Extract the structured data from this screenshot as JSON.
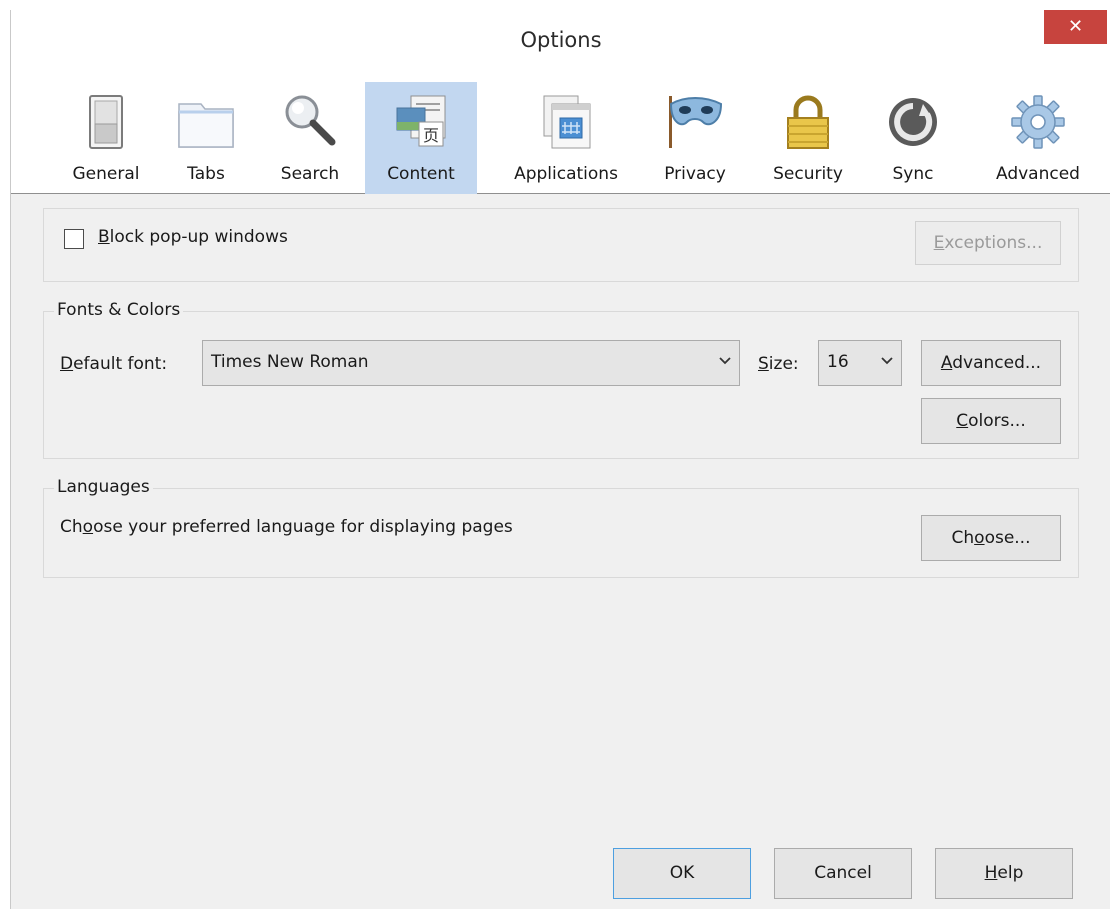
{
  "window": {
    "title": "Options",
    "close_glyph": "✕"
  },
  "tabs": [
    {
      "label": "General",
      "icon": "switch-icon"
    },
    {
      "label": "Tabs",
      "icon": "folder-tabs-icon"
    },
    {
      "label": "Search",
      "icon": "magnifier-icon"
    },
    {
      "label": "Content",
      "icon": "content-pages-icon",
      "selected": true
    },
    {
      "label": "Applications",
      "icon": "applications-window-icon"
    },
    {
      "label": "Privacy",
      "icon": "mask-icon"
    },
    {
      "label": "Security",
      "icon": "padlock-icon"
    },
    {
      "label": "Sync",
      "icon": "sync-icon"
    },
    {
      "label": "Advanced",
      "icon": "gear-icon"
    }
  ],
  "popups": {
    "block_label_accesskey": "B",
    "block_label_rest": "lock pop-up windows",
    "block_checked": false,
    "exceptions_accesskey": "E",
    "exceptions_rest": "xceptions...",
    "exceptions_disabled": true
  },
  "fonts": {
    "legend": "Fonts & Colors",
    "default_font_accesskey": "D",
    "default_font_rest": "efault font:",
    "default_font_value": "Times New Roman",
    "size_accesskey": "S",
    "size_rest": "ize:",
    "size_value": "16",
    "advanced_accesskey": "A",
    "advanced_rest": "dvanced...",
    "colors_accesskey": "C",
    "colors_rest": "olors..."
  },
  "languages": {
    "legend": "Languages",
    "desc_pre": "Ch",
    "desc_accesskey": "o",
    "desc_post": "ose your preferred language for displaying pages",
    "choose_pre": "Ch",
    "choose_accesskey": "o",
    "choose_post": "ose..."
  },
  "footer": {
    "ok_label": "OK",
    "cancel_label": "Cancel",
    "help_accesskey": "H",
    "help_rest": "elp"
  },
  "colors": {
    "selected_tab": "#c2d7f0",
    "close_button": "#c7443e",
    "dialog_bg": "#f0f0f0",
    "default_button_border": "#4d9fe0"
  }
}
